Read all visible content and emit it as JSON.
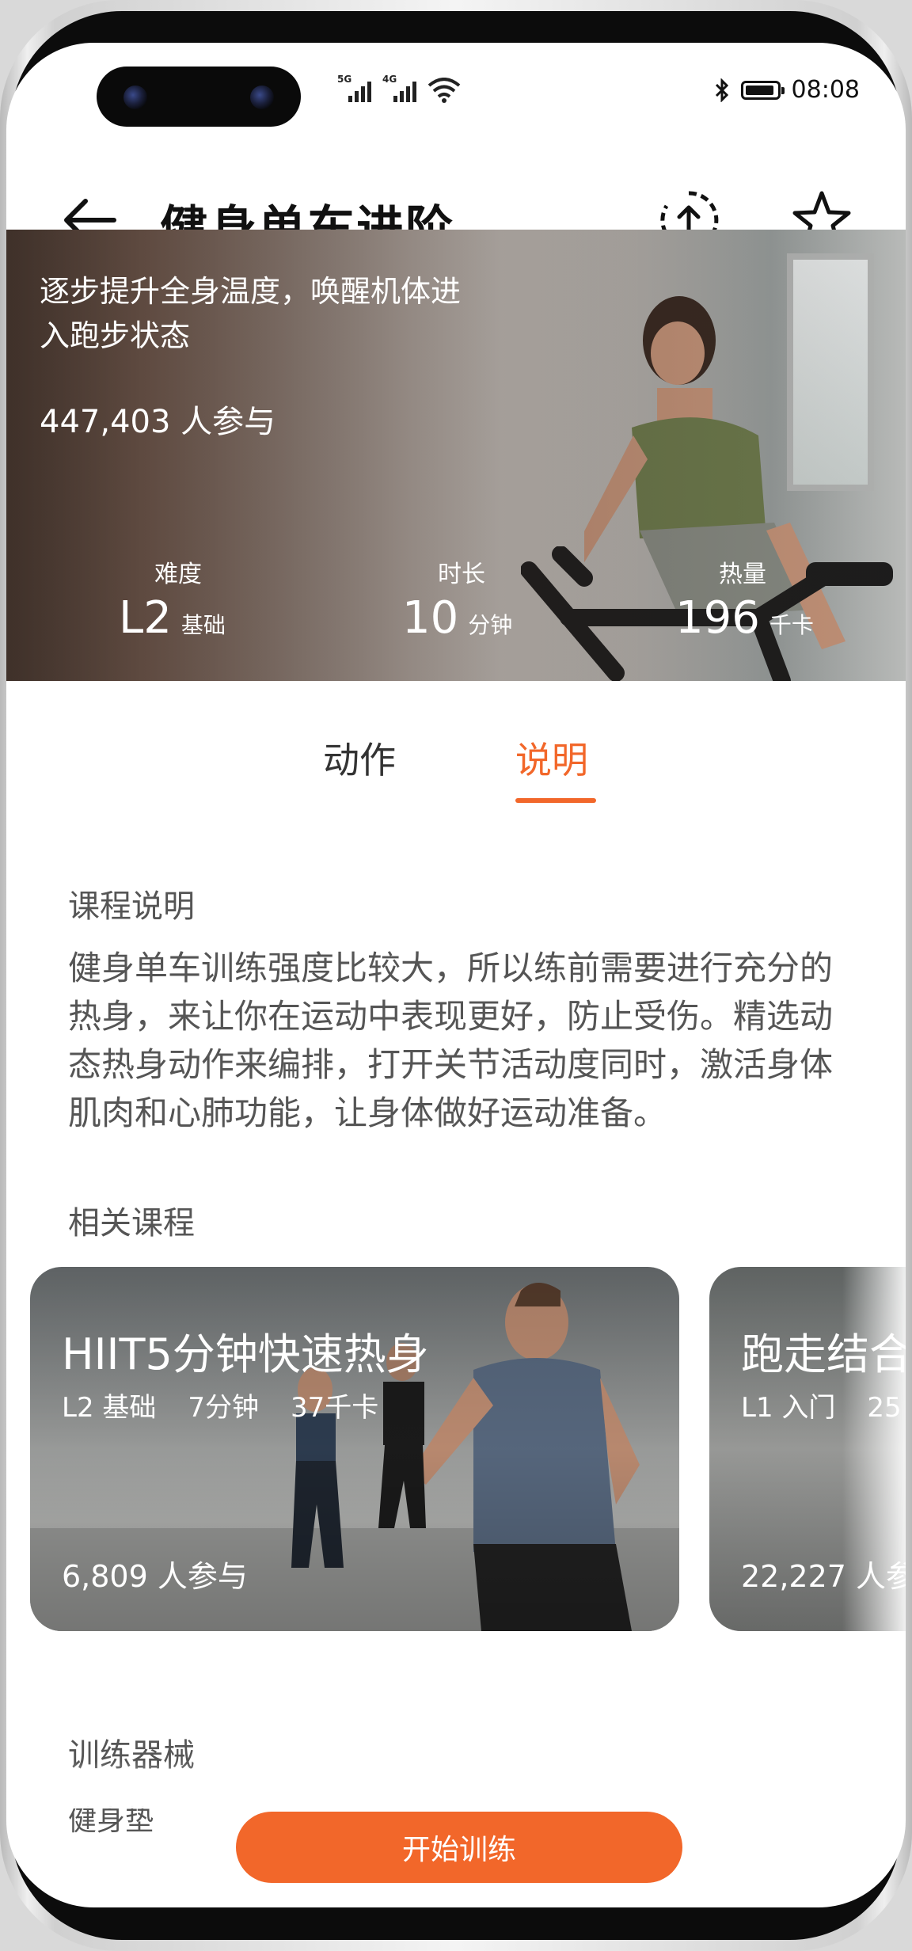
{
  "status_bar": {
    "signal1_label": "5G",
    "signal2_label": "4G",
    "time": "08:08"
  },
  "header": {
    "title": "健身单车进阶",
    "back_icon": "arrow-left-icon",
    "share_icon": "share-up-icon",
    "favorite_icon": "star-icon"
  },
  "hero": {
    "description": "逐步提升全身温度，唤醒机体进入跑步状态",
    "participants": "447,403 人参与",
    "stats": [
      {
        "label": "难度",
        "value": "L2",
        "unit": "基础"
      },
      {
        "label": "时长",
        "value": "10",
        "unit": "分钟"
      },
      {
        "label": "热量",
        "value": "196",
        "unit": "千卡"
      }
    ]
  },
  "tabs": [
    {
      "label": "动作",
      "active": false
    },
    {
      "label": "说明",
      "active": true
    }
  ],
  "course_description": {
    "title": "课程说明",
    "text": "健身单车训练强度比较大，所以练前需要进行充分的热身，来让你在运动中表现更好，防止受伤。精选动态热身动作来编排，打开关节活动度同时，激活身体肌肉和心肺功能，让身体做好运动准备。"
  },
  "related": {
    "title": "相关课程",
    "courses": [
      {
        "title": "HIIT5分钟快速热身",
        "level": "L2 基础",
        "duration": "7分钟",
        "calories": "37千卡",
        "participants": "6,809 人参与"
      },
      {
        "title": "跑走结合",
        "level": "L1 入门",
        "duration": "25",
        "calories": "",
        "participants": "22,227 人参"
      }
    ]
  },
  "equipment": {
    "title": "训练器械",
    "value": "健身垫"
  },
  "cta": {
    "label": "开始训练"
  },
  "colors": {
    "accent": "#f2672a",
    "text_primary": "#111111",
    "text_secondary": "#555555"
  }
}
